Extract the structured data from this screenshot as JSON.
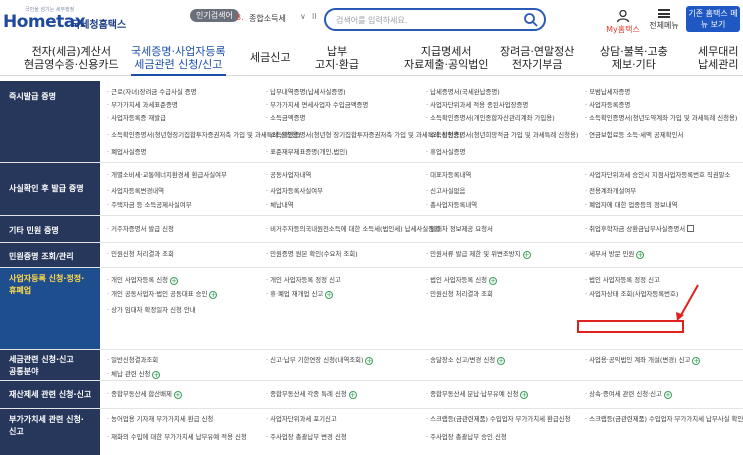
{
  "header": {
    "logo_top": "국민을 섬기는 세무행정",
    "logo_main": "Hometax",
    "logo_sub": "국세청홈택스",
    "popular_label": "인기검색어",
    "popular_rank": "3.",
    "popular_item": "종합소득세",
    "search_placeholder": "검색어를 입력하세요.",
    "my_tax": "My홈택스",
    "all_menu": "전체메뉴",
    "screen_btn": "기존 홈택스 메뉴 보기",
    "colors": {
      "brand": "#1f4aa0",
      "accent": "#e33e2b"
    }
  },
  "gnb": [
    {
      "line1": "전자(세금)계산서",
      "line2": "현금영수증·신용카드"
    },
    {
      "line1": "국세증명·사업자등록",
      "line2": "세금관련 신청/신고",
      "active": true
    },
    {
      "line1": "세금신고",
      "line2": ""
    },
    {
      "line1": "납부",
      "line2": "고지·환급"
    },
    {
      "line1": "지급명세서",
      "line2": "자료제출·공익법인"
    },
    {
      "line1": "장려금·연말정산",
      "line2": "전자기부금"
    },
    {
      "line1": "상담·불복·고충",
      "line2": "제보·기타"
    },
    {
      "line1": "세무대리",
      "line2": "납세관리"
    }
  ],
  "rows": [
    {
      "title": [
        "즉시발급 증명"
      ],
      "cells": [
        [
          "근로(자녀)장려금 수급사실 증명",
          "납부내역증명(납세사실증명)",
          "납세증명서(국세완납증명)",
          "모범납세자증명"
        ],
        [
          "부가가치세 과세표준증명",
          "부가가치세 면세사업자 수입금액증명",
          "사업자단위과세 적용 종된사업장증명",
          "사업자등록증명"
        ],
        [
          "사업자등록증 재발급",
          "소득금액증명",
          "소득확인증명서(개인종합자산관리계좌 가입용)",
          "소득확인증명서(청년도약계좌 가입 및 과세특례 신청용)"
        ],
        [
          "소득확인증명서(청년형장기집합투자증권저축 가입 및 과세특례 신청용)",
          "소득확인증명서(청년형 장기집합투자증권저축 가입 및 과세특례 신청용)",
          "소득확인증명서(청년희망적금 가입 및 과세특례 신청용)",
          "연금보험료등 소득·세액 공제확인서"
        ],
        [
          "폐업사실증명",
          "표준재무제표증명(개인,법인)",
          "휴업사실증명",
          ""
        ]
      ]
    },
    {
      "title": [
        "사실확인 후 발급 증명"
      ],
      "cells": [
        [
          "개별소비세·교통에너지환경세 환급사실여부",
          "공동사업자내역",
          "대표자등록내역",
          "사업자단위과세 승인시 지점사업자등록번호 직권말소"
        ],
        [
          "사업자등록변경내역",
          "사업자등록사실여부",
          "신고사실없음",
          "전용계좌개설여부"
        ],
        [
          "주택자금 등 소득공제사실여부",
          "체납내역",
          "총사업자등록내역",
          "폐업자에 대한 업종등의 정보내역"
        ]
      ]
    },
    {
      "title": [
        "기타 민원 증명"
      ],
      "cells": [
        [
          "거주자증명서 발급 신청",
          "비거주자등의국내원천소득에 대한 소득세(법인세) 납세사실증명",
          "일대차 정보제공 요청서",
          "취업후학자금 상환금납부사실증명서"
        ]
      ]
    },
    {
      "title": [
        "민원증명 조회/관리"
      ],
      "cells": [
        [
          "민원신청 처리결과 조회",
          "민원증명 원본 확인(수요처 조회)",
          "민원서류 발급 제한 및 위변조방지",
          "세무서 방문 민원"
        ]
      ]
    },
    {
      "title": [
        "사업자등록 신청·정정·",
        "휴폐업"
      ],
      "cells": [
        [
          "개인 사업자등록 신청",
          "개인 사업자등록 정정 신고",
          "법인 사업자등록 신청",
          "법인 사업자등록 정정 신고"
        ],
        [
          "개인 공동사업자·법인 공동대표 승인",
          "휴·폐업 재개업 신고",
          "민원신청 처리결과 조회",
          "사업자상태 조회(사업자등록번호)"
        ],
        [
          "상가 임대차 확정일자 신청 안내",
          "",
          "",
          ""
        ]
      ]
    },
    {
      "title": [
        "세금관련 신청·신고",
        "공통분야"
      ],
      "cells": [
        [
          "일반신청결과조회",
          "신고·납부 기한연장 신청(내역조회)",
          "송달장소 신고/변경 신청",
          "사업용·공익법인 계좌 개설(변경) 신고"
        ],
        [
          "체납 관련 신청",
          "",
          "",
          ""
        ]
      ]
    },
    {
      "title": [
        "재산제세 관련 신청·신고"
      ],
      "cells": [
        [
          "종합부동산세 합산배제",
          "종합부동산세 각종 특례 신청",
          "종합부동산세 분납·납부유예 신청",
          "상속·증여세 관련 신청·신고"
        ]
      ]
    },
    {
      "title": [
        "부가가치세 관련 신청·",
        "신고"
      ],
      "cells": [
        [
          "농어업용 기자재 부가가치세 환급 신청",
          "사업자단위과세 포기신고",
          "스크랩등(금관련제품) 수입업자 부가가치세 환급신청",
          "스크랩등(금관련제품) 수입업자 부가가치세 납부사실 확인신청"
        ],
        [
          "재화의 수입에 대한 부가가치세 납부유예 적용 신청",
          "주사업장 총괄납부 변경 신청",
          "주사업장 총괄납부 승인 신청",
          ""
        ]
      ]
    }
  ]
}
